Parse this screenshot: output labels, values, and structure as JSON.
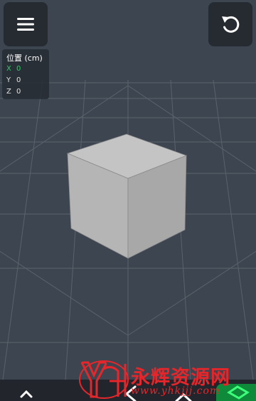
{
  "toolbar": {
    "menu_icon": "hamburger-menu-icon",
    "reset_icon": "undo-arrow-icon"
  },
  "coordinates": {
    "title": "位置 (cm)",
    "x_label": "X",
    "x_value": "0",
    "y_label": "Y",
    "y_value": "0",
    "z_label": "Z",
    "z_value": "0",
    "x_color": "#35c86b"
  },
  "scene": {
    "background_color": "#3d4550",
    "grid_color": "#5a626c",
    "object": "cube",
    "cube_color": "#b7b7b7"
  },
  "watermark": {
    "logo_text": "YH",
    "title": "永辉资源网",
    "url": "www.yhkjjj.com",
    "color": "#e5262b"
  },
  "bottom_bar": {
    "icons": [
      "chevron-up-icon",
      "chevron-left-icon",
      "chevron-up-icon",
      "cube-outline-icon"
    ]
  }
}
